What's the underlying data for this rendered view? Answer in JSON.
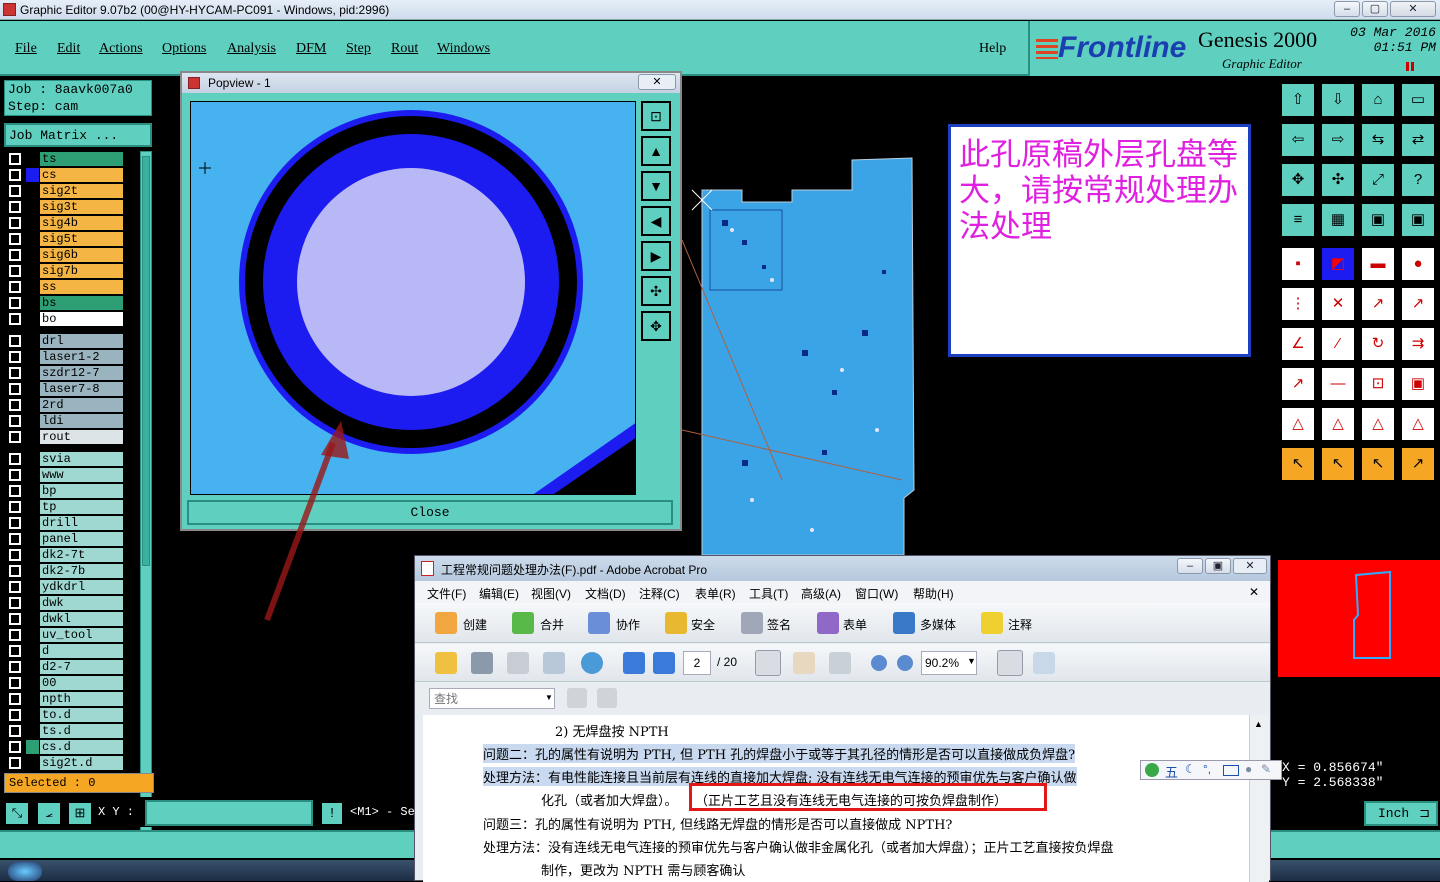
{
  "window": {
    "title": "Graphic Editor 9.07b2 (00@HY-HYCAM-PC091 - Windows, pid:2996)"
  },
  "menu": {
    "items": [
      "File",
      "Edit",
      "Actions",
      "Options",
      "Analysis",
      "DFM",
      "Step",
      "Rout",
      "Windows"
    ],
    "help": "Help"
  },
  "logo": {
    "brand": "Frontline",
    "product": "Genesis 2000",
    "subtitle": "Graphic Editor",
    "date": "03 Mar 2016",
    "time": "01:51 PM"
  },
  "job": {
    "job_label": "Job : 8aavk007a0",
    "step_label": "Step: cam",
    "matrix_button": "Job Matrix ..."
  },
  "layers": {
    "group1": [
      {
        "name": "ts",
        "color": "#2e9e75"
      },
      {
        "name": "cs",
        "color": "#f5b545",
        "swatch": "#1c1cf0"
      },
      {
        "name": "sig2t",
        "color": "#f5b545"
      },
      {
        "name": "sig3t",
        "color": "#f5b545"
      },
      {
        "name": "sig4b",
        "color": "#f5b545"
      },
      {
        "name": "sig5t",
        "color": "#f5b545"
      },
      {
        "name": "sig6b",
        "color": "#f5b545"
      },
      {
        "name": "sig7b",
        "color": "#f5b545"
      },
      {
        "name": "ss",
        "color": "#f5b545"
      },
      {
        "name": "bs",
        "color": "#2e9e75"
      },
      {
        "name": "bo",
        "color": "#ffffff"
      }
    ],
    "group2": [
      {
        "name": "drl",
        "color": "#99b3bf"
      },
      {
        "name": "laser1-2",
        "color": "#99b3bf"
      },
      {
        "name": "szdr12-7",
        "color": "#99b3bf"
      },
      {
        "name": "laser7-8",
        "color": "#99b3bf"
      },
      {
        "name": "2rd",
        "color": "#99b3bf"
      },
      {
        "name": "ldi",
        "color": "#99b3bf"
      },
      {
        "name": "rout",
        "color": "#dde4e8"
      }
    ],
    "group3": [
      {
        "name": "svia",
        "color": "#9fd8d0"
      },
      {
        "name": "www",
        "color": "#9fd8d0"
      },
      {
        "name": "bp",
        "color": "#9fd8d0"
      },
      {
        "name": "tp",
        "color": "#9fd8d0"
      },
      {
        "name": "drill",
        "color": "#9fd8d0"
      },
      {
        "name": "panel",
        "color": "#9fd8d0"
      },
      {
        "name": "dk2-7t",
        "color": "#9fd8d0"
      },
      {
        "name": "dk2-7b",
        "color": "#9fd8d0"
      },
      {
        "name": "ydkdrl",
        "color": "#9fd8d0"
      },
      {
        "name": "dwk",
        "color": "#9fd8d0"
      },
      {
        "name": "dwkl",
        "color": "#9fd8d0"
      },
      {
        "name": "uv_tool",
        "color": "#9fd8d0"
      },
      {
        "name": "d",
        "color": "#9fd8d0"
      },
      {
        "name": "d2-7",
        "color": "#9fd8d0"
      },
      {
        "name": "00",
        "color": "#9fd8d0"
      },
      {
        "name": "npth",
        "color": "#9fd8d0"
      },
      {
        "name": "to.d",
        "color": "#9fd8d0"
      },
      {
        "name": "ts.d",
        "color": "#9fd8d0"
      },
      {
        "name": "cs.d",
        "color": "#9fd8d0",
        "swatch": "#2e9e75"
      },
      {
        "name": "sig2t.d",
        "color": "#9fd8d0"
      }
    ]
  },
  "selected": "Selected : 0",
  "statusbar": {
    "xy_label": "X Y :",
    "mode": "<M1> - Se"
  },
  "coords": {
    "x": "X = 0.856674\"",
    "y": "Y = 2.568338\""
  },
  "unit": "Inch",
  "popview": {
    "title": "Popview - 1",
    "close": "Close"
  },
  "note": {
    "text": "此孔原稿外层孔盘等大，请按常规处理办法处理"
  },
  "acrobat": {
    "title": "工程常规问题处理办法(F).pdf - Adobe Acrobat Pro",
    "menu": [
      "文件(F)",
      "编辑(E)",
      "视图(V)",
      "文档(D)",
      "注释(C)",
      "表单(R)",
      "工具(T)",
      "高级(A)",
      "窗口(W)",
      "帮助(H)"
    ],
    "toolbar": [
      "创建",
      "合并",
      "协作",
      "安全",
      "签名",
      "表单",
      "多媒体",
      "注释"
    ],
    "page": "2",
    "page_total": "/ 20",
    "zoom": "90.2%",
    "find_placeholder": "查找",
    "lines": [
      "2) 无焊盘按 NPTH",
      "问题二：孔的属性有说明为 PTH, 但 PTH 孔的焊盘小于或等于其孔径的情形是否可以直接做成负焊盘?",
      "处理方法：有电性能连接且当前层有连线的直接加大焊盘; 没有连线无电气连接的预审优先与客户确认做",
      "化孔（或者加大焊盘）。",
      "（正片工艺且没有连线无电气连接的可按负焊盘制作）",
      "问题三：孔的属性有说明为 PTH, 但线路无焊盘的情形是否可以直接做成 NPTH?",
      "处理方法：没有连线无电气连接的预审优先与客户确认做非金属化孔（或者加大焊盘）；正片工艺直接按负焊盘",
      "制作，更改为 NPTH 需与顾客确认"
    ]
  },
  "ime": {
    "label": "五"
  }
}
